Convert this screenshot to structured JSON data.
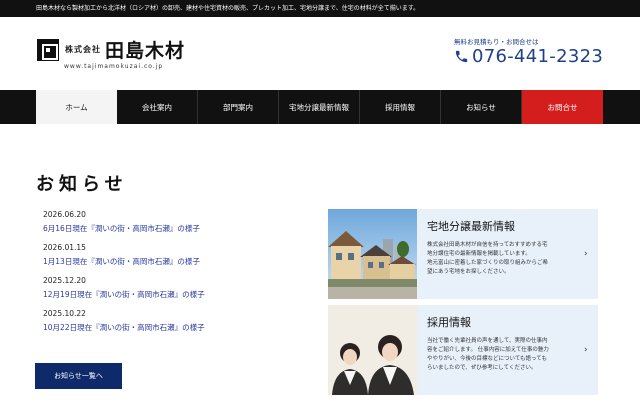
{
  "topbar": {
    "text": "田島木材なら製材加工から北洋材（ロシア材）の卸売、建材や住宅資材の販売、プレカット加工、宅地分譲まで、住宅の材料が全て揃います。"
  },
  "logo": {
    "small": "株式会社",
    "name": "田島木材",
    "url": "www.tajimamokuzai.co.jp"
  },
  "contact": {
    "label": "無料お見積もり・お問合せは",
    "phone": "076-441-2323"
  },
  "nav": {
    "items": [
      {
        "label": "ホーム"
      },
      {
        "label": "会社案内"
      },
      {
        "label": "部門案内"
      },
      {
        "label": "宅地分譲最新情報"
      },
      {
        "label": "採用情報"
      },
      {
        "label": "お知らせ"
      },
      {
        "label": "お問合せ"
      }
    ]
  },
  "page_title": "お知らせ",
  "news": [
    {
      "date": "2026.06.20",
      "title": "6月16日現在『潤いの街・高岡市石瀬』の様子"
    },
    {
      "date": "2026.01.15",
      "title": "1月13日現在『潤いの街・高岡市石瀬』の様子"
    },
    {
      "date": "2025.12.20",
      "title": "12月19日現在『潤いの街・高岡市石瀬』の様子"
    },
    {
      "date": "2025.10.22",
      "title": "10月22日現在『潤いの街・高岡市石瀬』の様子"
    }
  ],
  "more_button": "お知らせ一覧へ",
  "cards": [
    {
      "title": "宅地分譲最新情報",
      "lines": [
        "株式会社田島木材が自信を持っておすすめする宅",
        "地分譲住宅の最新情報を掲載しています。",
        "地元富山に密着した家づくりの取り組みからご希",
        "望にあう宅地をお探しください。"
      ]
    },
    {
      "title": "採用情報",
      "lines": [
        "当社で働く先輩社員の声を通して、実際の仕事内",
        "容をご紹介します。 仕事内容に加えて仕事の魅力",
        "ややりがい、今後の目標などについても語っても",
        "らいましたので、ぜひ参考にしてください。"
      ]
    }
  ],
  "colors": {
    "nav_bg": "#111111",
    "contact_red": "#d41e1e",
    "navy": "#0f2a6b",
    "phone_blue": "#1f3f8a",
    "link_blue": "#2a3aa0",
    "card_bg": "#e8f1fa"
  }
}
